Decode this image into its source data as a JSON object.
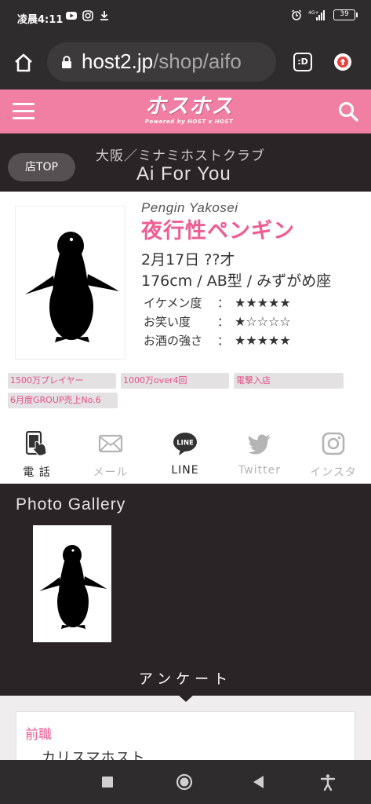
{
  "status_bar": {
    "time": "凌晨4:11",
    "battery": "39",
    "app_icons": [
      "youtube-icon",
      "instagram-icon",
      "download-icon"
    ],
    "system_icons": [
      "alarm-icon",
      "signal-icon",
      "battery-icon"
    ]
  },
  "browser": {
    "url_host": "host2.jp",
    "url_path": "/shop/aifo",
    "tabs_label": ":D"
  },
  "site": {
    "logo": "ホスホス",
    "logo_sub": "Powered by HOST x HOST",
    "brand_color": "#f17ea3"
  },
  "shop": {
    "top_button": "店TOP",
    "area": "大阪／ミナミホストクラブ",
    "name": "Ai For You"
  },
  "profile": {
    "name_roman": "Pengin Yakosei",
    "name_jp": "夜行性ペンギン",
    "birthday": "2月17日 ??才",
    "specs": "176cm / AB型 / みずがめ座",
    "ratings": [
      {
        "label": "イケメン度",
        "colon": "：",
        "stars": "★★★★★",
        "value": 5
      },
      {
        "label": "お笑い度",
        "colon": "：",
        "stars": "★☆☆☆☆",
        "value": 1
      },
      {
        "label": "お酒の強さ",
        "colon": "：",
        "stars": "★★★★★",
        "value": 5
      }
    ],
    "tags": [
      "1500万プレイヤー",
      "1000万over4回",
      "電撃入店",
      "6月度GROUP売上No.6"
    ]
  },
  "contacts": [
    {
      "label": "電 話",
      "icon": "phone-tap-icon",
      "active": true
    },
    {
      "label": "メール",
      "icon": "mail-icon",
      "active": false
    },
    {
      "label": "LINE",
      "icon": "line-icon",
      "active": true
    },
    {
      "label": "Twitter",
      "icon": "twitter-icon",
      "active": false
    },
    {
      "label": "インスタ",
      "icon": "instagram-icon",
      "active": false
    }
  ],
  "gallery": {
    "title": "Photo Gallery"
  },
  "survey": {
    "label": "アンケート",
    "question": "前職",
    "answer": "カリスマホスト"
  }
}
